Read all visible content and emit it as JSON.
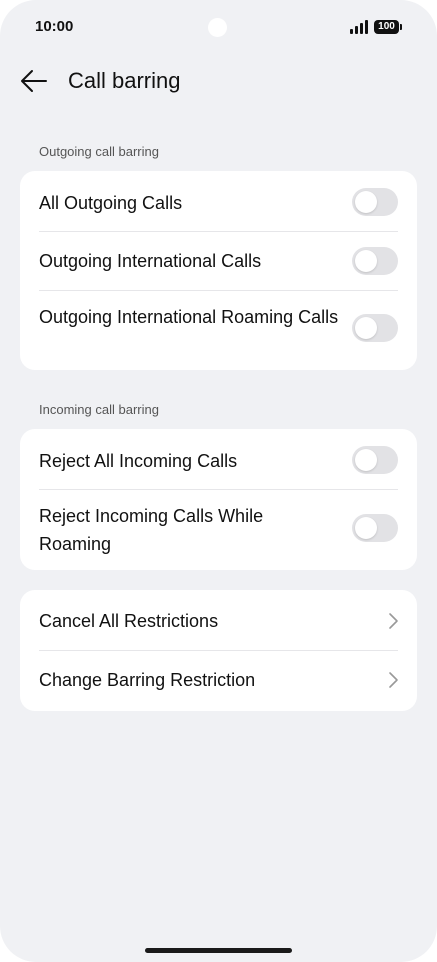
{
  "status_bar": {
    "time": "10:00",
    "battery": "100"
  },
  "header": {
    "title": "Call barring"
  },
  "outgoing": {
    "label": "Outgoing call barring",
    "items": [
      {
        "label": "All Outgoing Calls",
        "enabled": false
      },
      {
        "label": "Outgoing International Calls",
        "enabled": false
      },
      {
        "label": "Outgoing International Roaming Calls",
        "enabled": false
      }
    ]
  },
  "incoming": {
    "label": "Incoming call barring",
    "items": [
      {
        "label": "Reject All Incoming Calls",
        "enabled": false
      },
      {
        "label": "Reject Incoming Calls While Roaming",
        "enabled": false
      }
    ]
  },
  "actions": {
    "items": [
      {
        "label": "Cancel All Restrictions"
      },
      {
        "label": "Change Barring Restriction"
      }
    ]
  }
}
